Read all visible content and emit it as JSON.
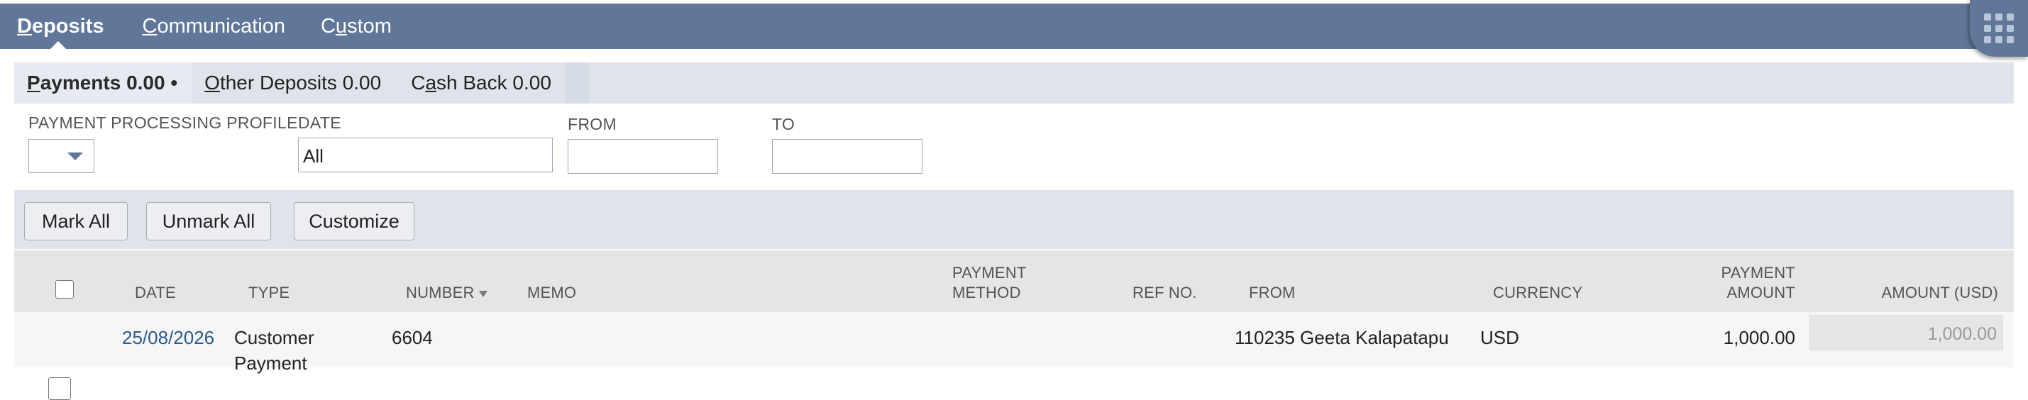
{
  "topnav": {
    "tabs": [
      {
        "pre": "",
        "ul": "D",
        "post": "eposits"
      },
      {
        "pre": "",
        "ul": "C",
        "post": "ommunication"
      },
      {
        "pre": "C",
        "ul": "u",
        "post": "stom"
      }
    ]
  },
  "subtabs": {
    "payments": {
      "ul": "P",
      "post": "ayments 0.00 •"
    },
    "other_deposits": {
      "pre": "",
      "ul": "O",
      "post": "ther Deposits 0.00"
    },
    "cash_back": {
      "pre": "C",
      "ul": "a",
      "post": "sh Back 0.00"
    }
  },
  "filters": {
    "profile_label": "PAYMENT PROCESSING PROFILE",
    "profile_value": "",
    "date_label": "DATE",
    "date_value": "All",
    "from_label": "FROM",
    "from_value": "",
    "to_label": "TO",
    "to_value": ""
  },
  "buttons": {
    "mark_all": "Mark All",
    "unmark_all": "Unmark All",
    "customize": "Customize"
  },
  "table": {
    "headers": {
      "date": "DATE",
      "type": "TYPE",
      "number": "NUMBER",
      "memo": "MEMO",
      "payment_method_1": "PAYMENT",
      "payment_method_2": "METHOD",
      "ref_no": "REF NO.",
      "from": "FROM",
      "currency": "CURRENCY",
      "payment_amount_1": "PAYMENT",
      "payment_amount_2": "AMOUNT",
      "amount_usd": "AMOUNT (USD)"
    },
    "rows": [
      {
        "date": "25/08/2026",
        "type_1": "Customer",
        "type_2": "Payment",
        "number": "6604",
        "memo": "",
        "payment_method": "",
        "ref_no": "",
        "from": "110235 Geeta Kalapatapu",
        "currency": "USD",
        "payment_amount": "1,000.00",
        "amount_usd": "1,000.00"
      }
    ]
  },
  "colors": {
    "nav_bg": "#607799",
    "subtab_bg": "#dfe4eb",
    "header_bg": "#e5e5e5",
    "link": "#2e5a8d"
  },
  "icons": {
    "app_launcher": "grid-dots-icon",
    "dropdown": "caret-down-icon",
    "sort": "sort-down-icon"
  }
}
